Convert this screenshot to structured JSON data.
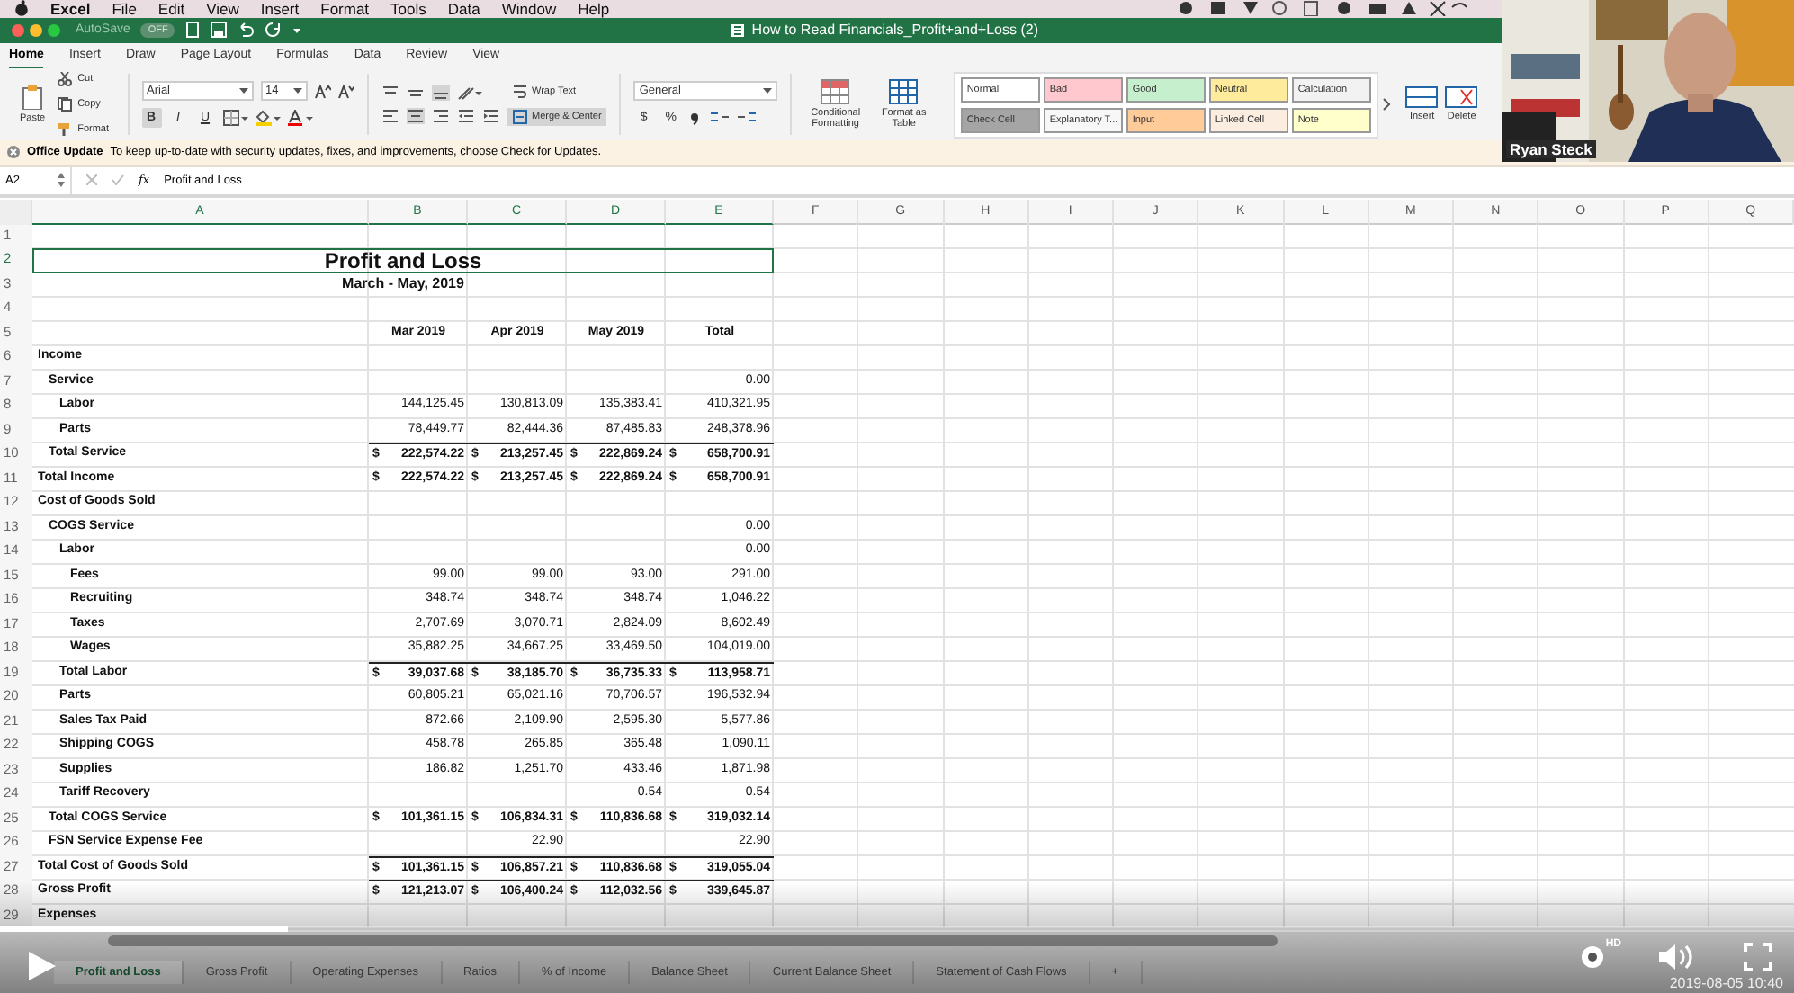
{
  "menu_bar": {
    "items": [
      "Excel",
      "File",
      "Edit",
      "View",
      "Insert",
      "Format",
      "Tools",
      "Data",
      "Window",
      "Help"
    ]
  },
  "title_bar": {
    "autosave": "AutoSave",
    "autosave_state": "OFF",
    "title": "How to Read Financials_Profit+and+Loss (2)"
  },
  "ribbon": {
    "tabs": [
      {
        "label": "Home",
        "selected": true
      },
      {
        "label": "Insert",
        "selected": false
      },
      {
        "label": "Draw",
        "selected": false
      },
      {
        "label": "Page Layout",
        "selected": false
      },
      {
        "label": "Formulas",
        "selected": false
      },
      {
        "label": "Data",
        "selected": false
      },
      {
        "label": "Review",
        "selected": false
      },
      {
        "label": "View",
        "selected": false
      }
    ],
    "paste": "Paste",
    "cut": "Cut",
    "copy": "Copy",
    "format_painter": "Format",
    "font_name": "Arial",
    "font_size": "14",
    "format_buttons": [
      {
        "label": "B",
        "on": true
      },
      {
        "label": "I",
        "on": false
      },
      {
        "label": "U",
        "on": false
      }
    ],
    "wrap_text": {
      "label": "Wrap Text",
      "on": false
    },
    "merge_center": {
      "label": "Merge & Center",
      "on": true
    },
    "number_format": "General",
    "currency": "$",
    "percent": "%",
    "conditional_formatting": "Conditional Formatting",
    "format_as_table": "Format as Table",
    "styles": [
      {
        "label": "Normal",
        "color": "#ffffff"
      },
      {
        "label": "Bad",
        "color": "#ffc7ce"
      },
      {
        "label": "Good",
        "color": "#c6efce"
      },
      {
        "label": "Neutral",
        "color": "#ffeb9c"
      },
      {
        "label": "Calculation",
        "color": "#f2f2f2"
      },
      {
        "label": "Check Cell",
        "color": "#a5a5a5"
      },
      {
        "label": "Explanatory T...",
        "color": "#f7f7f7"
      },
      {
        "label": "Input",
        "color": "#ffcc99"
      },
      {
        "label": "Linked Cell",
        "color": "#fbeee0"
      },
      {
        "label": "Note",
        "color": "#ffffcc"
      }
    ],
    "insert": "Insert",
    "delete": "Delete"
  },
  "webcam": {
    "kind": "picture",
    "caption": "Ryan Steck"
  },
  "update_bar": {
    "title": "Office Update",
    "message": "To keep up-to-date with security updates, fixes, and improvements, choose Check for Updates."
  },
  "formula_bar": {
    "name_box": "A2",
    "fx": "fx",
    "formula": "Profit and Loss"
  },
  "sheet": {
    "columns": [
      {
        "label": "A",
        "selected": true
      },
      {
        "label": "B",
        "selected": true
      },
      {
        "label": "C",
        "selected": true
      },
      {
        "label": "D",
        "selected": true
      },
      {
        "label": "E",
        "selected": true
      },
      {
        "label": "F",
        "selected": false
      },
      {
        "label": "G",
        "selected": false
      },
      {
        "label": "H",
        "selected": false
      },
      {
        "label": "I",
        "selected": false
      },
      {
        "label": "J",
        "selected": false
      },
      {
        "label": "K",
        "selected": false
      },
      {
        "label": "L",
        "selected": false
      },
      {
        "label": "M",
        "selected": false
      },
      {
        "label": "N",
        "selected": false
      },
      {
        "label": "O",
        "selected": false
      },
      {
        "label": "P",
        "selected": false
      },
      {
        "label": "Q",
        "selected": false
      }
    ],
    "row_headers": [
      {
        "label": "1",
        "selected": false
      },
      {
        "label": "2",
        "selected": true
      },
      {
        "label": "3",
        "selected": false
      },
      {
        "label": "4",
        "selected": false
      },
      {
        "label": "5",
        "selected": false
      },
      {
        "label": "6",
        "selected": false
      },
      {
        "label": "7",
        "selected": false
      },
      {
        "label": "8",
        "selected": false
      },
      {
        "label": "9",
        "selected": false
      },
      {
        "label": "10",
        "selected": false
      },
      {
        "label": "11",
        "selected": false
      },
      {
        "label": "12",
        "selected": false
      },
      {
        "label": "13",
        "selected": false
      },
      {
        "label": "14",
        "selected": false
      },
      {
        "label": "15",
        "selected": false
      },
      {
        "label": "16",
        "selected": false
      },
      {
        "label": "17",
        "selected": false
      },
      {
        "label": "18",
        "selected": false
      },
      {
        "label": "19",
        "selected": false
      },
      {
        "label": "20",
        "selected": false
      },
      {
        "label": "21",
        "selected": false
      },
      {
        "label": "22",
        "selected": false
      },
      {
        "label": "23",
        "selected": false
      },
      {
        "label": "24",
        "selected": false
      },
      {
        "label": "25",
        "selected": false
      },
      {
        "label": "26",
        "selected": false
      },
      {
        "label": "27",
        "selected": false
      },
      {
        "label": "28",
        "selected": false
      },
      {
        "label": "29",
        "selected": false
      }
    ],
    "title": "Profit and Loss",
    "period": "March - May, 2019",
    "headers": [
      "Mar 2019",
      "Apr 2019",
      "May 2019",
      "Total"
    ],
    "lines": [
      {
        "label": "Income",
        "children": [
          {
            "label": "Service",
            "cells": {
              "E": "0.00"
            },
            "children": [
              {
                "label": "Labor",
                "cells": {
                  "B": "144,125.45",
                  "C": "130,813.09",
                  "D": "135,383.41",
                  "E": "410,321.95"
                }
              },
              {
                "label": "Parts",
                "cells": {
                  "B": "78,449.77",
                  "C": "82,444.36",
                  "D": "87,485.83",
                  "E": "248,378.96"
                }
              }
            ]
          },
          {
            "label": "Total Service",
            "rule": true,
            "cells": {
              "B": {
                "currency": "$",
                "amount": "222,574.22"
              },
              "C": {
                "currency": "$",
                "amount": "213,257.45"
              },
              "D": {
                "currency": "$",
                "amount": "222,869.24"
              },
              "E": {
                "currency": "$",
                "amount": "658,700.91"
              }
            }
          }
        ]
      },
      {
        "label": "Total Income",
        "rule": false,
        "cells": {
          "B": {
            "currency": "$",
            "amount": "222,574.22"
          },
          "C": {
            "currency": "$",
            "amount": "213,257.45"
          },
          "D": {
            "currency": "$",
            "amount": "222,869.24"
          },
          "E": {
            "currency": "$",
            "amount": "658,700.91"
          }
        }
      },
      {
        "label": "Cost of Goods Sold",
        "children": [
          {
            "label": "COGS Service",
            "cells": {
              "E": "0.00"
            },
            "children": [
              {
                "label": "Labor",
                "cells": {
                  "E": "0.00"
                },
                "children": [
                  {
                    "label": "Fees",
                    "cells": {
                      "B": "99.00",
                      "C": "99.00",
                      "D": "93.00",
                      "E": "291.00"
                    }
                  },
                  {
                    "label": "Recruiting",
                    "cells": {
                      "B": "348.74",
                      "C": "348.74",
                      "D": "348.74",
                      "E": "1,046.22"
                    }
                  },
                  {
                    "label": "Taxes",
                    "cells": {
                      "B": "2,707.69",
                      "C": "3,070.71",
                      "D": "2,824.09",
                      "E": "8,602.49"
                    }
                  },
                  {
                    "label": "Wages",
                    "cells": {
                      "B": "35,882.25",
                      "C": "34,667.25",
                      "D": "33,469.50",
                      "E": "104,019.00"
                    }
                  }
                ]
              },
              {
                "label": "Total Labor",
                "rule": true,
                "cells": {
                  "B": {
                    "currency": "$",
                    "amount": "39,037.68"
                  },
                  "C": {
                    "currency": "$",
                    "amount": "38,185.70"
                  },
                  "D": {
                    "currency": "$",
                    "amount": "36,735.33"
                  },
                  "E": {
                    "currency": "$",
                    "amount": "113,958.71"
                  }
                }
              },
              {
                "label": "Parts",
                "cells": {
                  "B": "60,805.21",
                  "C": "65,021.16",
                  "D": "70,706.57",
                  "E": "196,532.94"
                }
              },
              {
                "label": "Sales Tax Paid",
                "cells": {
                  "B": "872.66",
                  "C": "2,109.90",
                  "D": "2,595.30",
                  "E": "5,577.86"
                }
              },
              {
                "label": "Shipping COGS",
                "cells": {
                  "B": "458.78",
                  "C": "265.85",
                  "D": "365.48",
                  "E": "1,090.11"
                }
              },
              {
                "label": "Supplies",
                "cells": {
                  "B": "186.82",
                  "C": "1,251.70",
                  "D": "433.46",
                  "E": "1,871.98"
                }
              },
              {
                "label": "Tariff Recovery",
                "cells": {
                  "D": "0.54",
                  "E": "0.54"
                }
              }
            ]
          },
          {
            "label": "Total COGS Service",
            "rule": false,
            "cells": {
              "B": {
                "currency": "$",
                "amount": "101,361.15"
              },
              "C": {
                "currency": "$",
                "amount": "106,834.31"
              },
              "D": {
                "currency": "$",
                "amount": "110,836.68"
              },
              "E": {
                "currency": "$",
                "amount": "319,032.14"
              }
            }
          },
          {
            "label": "FSN Service Expense Fee",
            "cells": {
              "C": "22.90",
              "E": "22.90"
            }
          }
        ]
      },
      {
        "label": "Total Cost of Goods Sold",
        "rule": true,
        "cells": {
          "B": {
            "currency": "$",
            "amount": "101,361.15"
          },
          "C": {
            "currency": "$",
            "amount": "106,857.21"
          },
          "D": {
            "currency": "$",
            "amount": "110,836.68"
          },
          "E": {
            "currency": "$",
            "amount": "319,055.04"
          }
        }
      },
      {
        "label": "Gross Profit",
        "rule": true,
        "cells": {
          "B": {
            "currency": "$",
            "amount": "121,213.07"
          },
          "C": {
            "currency": "$",
            "amount": "106,400.24"
          },
          "D": {
            "currency": "$",
            "amount": "112,032.56"
          },
          "E": {
            "currency": "$",
            "amount": "339,645.87"
          }
        }
      },
      {
        "label": "Expenses"
      }
    ]
  },
  "sheet_tabs": [
    {
      "label": "Profit and Loss",
      "selected": true
    },
    {
      "label": "Gross Profit",
      "selected": false
    },
    {
      "label": "Operating Expenses",
      "selected": false
    },
    {
      "label": "Ratios",
      "selected": false
    },
    {
      "label": "% of Income",
      "selected": false
    },
    {
      "label": "Balance Sheet",
      "selected": false
    },
    {
      "label": "Current Balance Sheet",
      "selected": false
    },
    {
      "label": "Statement of Cash Flows",
      "selected": false
    },
    {
      "label": "+",
      "selected": false
    }
  ],
  "video": {
    "progress": {
      "level": 0.16
    },
    "hd_badge": "HD",
    "timestamp": "2019-08-05 10:40"
  }
}
